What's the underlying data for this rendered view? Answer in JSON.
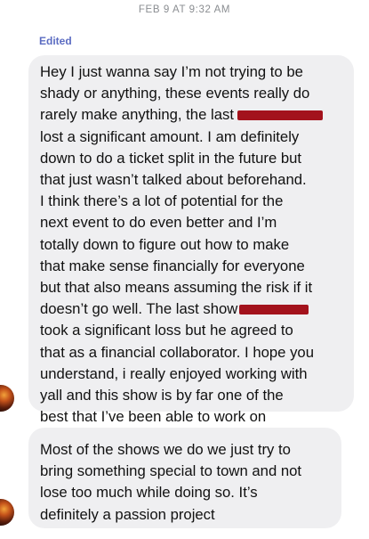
{
  "conversation": {
    "timestamp": "FEB 9 AT 9:32 AM",
    "edited_label": "Edited"
  },
  "messages": [
    {
      "lines": [
        "Hey I just wanna say I’m not trying to be",
        "shady or anything, these events really do",
        "rarely make anything, the last",
        "lost a significant amount. I am definitely",
        "down to do a ticket split in the future but",
        "that just wasn’t talked about beforehand.",
        "I think there’s a lot of potential for the",
        "next event to do even better and I’m",
        "totally down to figure out how to make",
        "that make sense financially for everyone",
        "but that also means assuming the risk if it",
        "doesn’t go well. The last show",
        "took a significant loss but he agreed to",
        "that as a financial collaborator. I hope you",
        "understand, i really enjoyed working with",
        "yall and this show is by far one of the",
        "best that I’ve been able to work on"
      ]
    },
    {
      "lines": [
        "Most of the shows we do we just try to",
        "bring something special to town and not",
        "lose too much while doing so. It’s",
        "definitely a passion project"
      ]
    }
  ],
  "colors": {
    "bubble_background": "#efeff1",
    "edited_accent": "#5b6cc2",
    "redaction": "#a3121c",
    "timestamp": "#8a8d91"
  }
}
